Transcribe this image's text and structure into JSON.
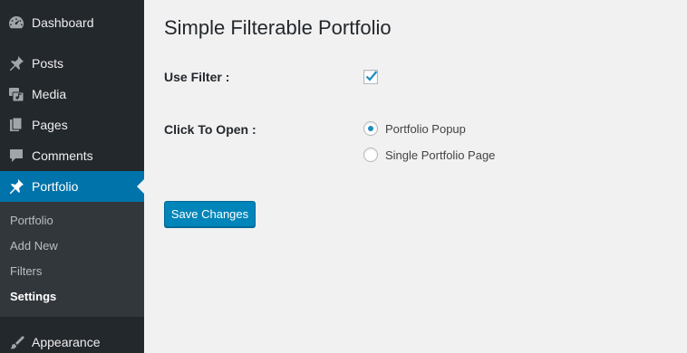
{
  "sidebar": {
    "items": [
      {
        "label": "Dashboard",
        "icon": "dashboard-icon"
      },
      {
        "label": "Posts",
        "icon": "pin-icon"
      },
      {
        "label": "Media",
        "icon": "media-icon"
      },
      {
        "label": "Pages",
        "icon": "pages-icon"
      },
      {
        "label": "Comments",
        "icon": "comment-icon"
      },
      {
        "label": "Portfolio",
        "icon": "pin-icon",
        "active": true
      },
      {
        "label": "Appearance",
        "icon": "brush-icon"
      }
    ],
    "submenu": [
      {
        "label": "Portfolio"
      },
      {
        "label": "Add New"
      },
      {
        "label": "Filters"
      },
      {
        "label": "Settings",
        "current": true
      }
    ]
  },
  "main": {
    "title": "Simple Filterable Portfolio",
    "use_filter": {
      "label": "Use Filter :",
      "checked": true
    },
    "click_to_open": {
      "label": "Click To Open :",
      "options": [
        {
          "label": "Portfolio Popup",
          "selected": true
        },
        {
          "label": "Single Portfolio Page",
          "selected": false
        }
      ]
    },
    "save_label": "Save Changes"
  },
  "colors": {
    "sidebar_bg": "#23282d",
    "submenu_bg": "#32373c",
    "active_bg": "#0073aa",
    "primary_button": "#0085ba",
    "page_bg": "#f1f1f1"
  }
}
